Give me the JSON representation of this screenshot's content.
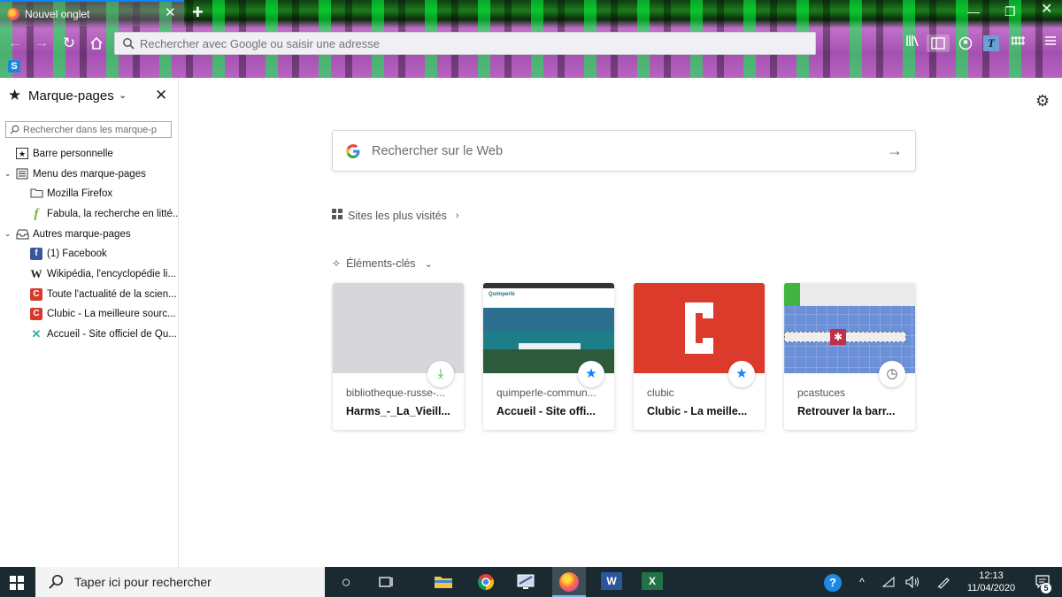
{
  "browser": {
    "tab": {
      "title": "Nouvel onglet"
    },
    "url_bar": {
      "placeholder": "Rechercher avec Google ou saisir une adresse"
    },
    "toolbar_icons": [
      "library-icon",
      "sidebar-icon",
      "account-icon",
      "translate-icon",
      "extension-icon",
      "menu-icon"
    ]
  },
  "sidebar": {
    "title": "Marque-pages",
    "search_placeholder": "Rechercher dans les marque-p",
    "items": [
      {
        "label": "Barre personnelle",
        "icon": "star-box-icon",
        "level": 0
      },
      {
        "label": "Menu des marque-pages",
        "icon": "menu-folder-icon",
        "level": 0,
        "expanded": true
      },
      {
        "label": "Mozilla Firefox",
        "icon": "folder-icon",
        "level": 1
      },
      {
        "label": "Fabula, la recherche en litté...",
        "icon": "fabula-icon",
        "level": 1
      },
      {
        "label": "Autres marque-pages",
        "icon": "inbox-folder-icon",
        "level": 0,
        "expanded": true
      },
      {
        "label": "(1) Facebook",
        "icon": "facebook-icon",
        "level": 1
      },
      {
        "label": "Wikipédia, l'encyclopédie li...",
        "icon": "wikipedia-icon",
        "level": 1
      },
      {
        "label": "Toute l'actualité de la scien...",
        "icon": "clubic-icon",
        "level": 1
      },
      {
        "label": "Clubic - La meilleure sourc...",
        "icon": "clubic-icon",
        "level": 1
      },
      {
        "label": "Accueil - Site officiel de Qu...",
        "icon": "quimperle-icon",
        "level": 1
      }
    ]
  },
  "newtab": {
    "search_placeholder": "Rechercher sur le Web",
    "top_sites_label": "Sites les plus visités",
    "highlights_label": "Éléments-clés",
    "cards": [
      {
        "host": "bibliotheque-russe-...",
        "title": "Harms_-_La_Vieill...",
        "badge": "download-icon"
      },
      {
        "host": "quimperle-commun...",
        "title": "Accueil - Site offi...",
        "badge": "bookmark-star-icon"
      },
      {
        "host": "clubic",
        "title": "Clubic - La meille...",
        "badge": "bookmark-star-icon"
      },
      {
        "host": "pcastuces",
        "title": "Retrouver la barr...",
        "badge": "history-clock-icon"
      }
    ]
  },
  "taskbar": {
    "search_placeholder": "Taper ici pour rechercher",
    "time": "12:13",
    "date": "11/04/2020",
    "notification_count": "5"
  },
  "colors": {
    "accent": "#0a84ff",
    "clubic_red": "#d8392b",
    "taskbar": "#1b2a31"
  }
}
